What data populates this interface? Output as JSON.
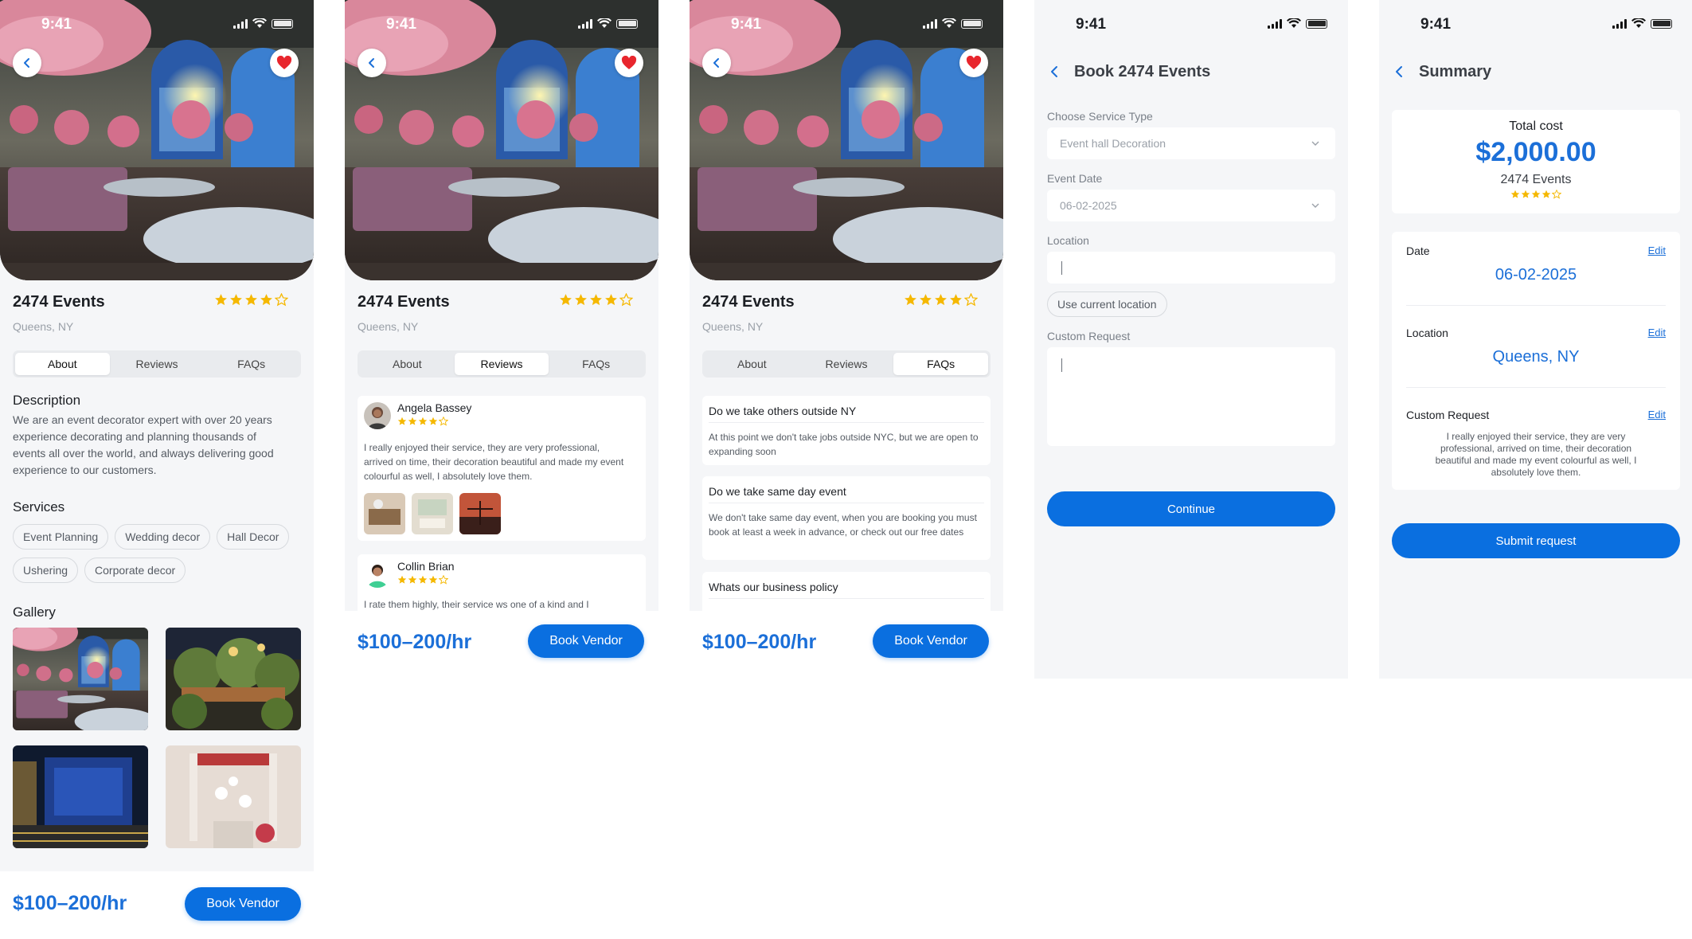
{
  "status": {
    "time": "9:41"
  },
  "vendor": {
    "name": "2474 Events",
    "location": "Queens, NY",
    "rating": 4,
    "rating_max": 5,
    "price": "$100–200/hr",
    "book_label": "Book Vendor"
  },
  "tabs": [
    "About",
    "Reviews",
    "FAQs"
  ],
  "about": {
    "description_title": "Description",
    "description": "We are an event decorator expert with over 20 years experience decorating and planning thousands of events all over the world, and always delivering good experience to our customers.",
    "services_title": "Services",
    "services": [
      "Event Planning",
      "Wedding decor",
      "Hall Decor",
      "Ushering",
      "Corporate decor"
    ],
    "gallery_title": "Gallery"
  },
  "reviews": [
    {
      "name": "Angela Bassey",
      "rating": 4,
      "text": "I really enjoyed their service, they are very professional, arrived on time, their decoration beautiful and made my event colourful as well, I absolutely love them."
    },
    {
      "name": "Collin Brian",
      "rating": 4,
      "text": "I rate them highly, their service ws one of a kind and I"
    }
  ],
  "faqs": [
    {
      "q": "Do we take others outside NY",
      "a": "At this point we don't take jobs outside NYC, but we are open to expanding soon"
    },
    {
      "q": "Do we take same day event",
      "a": "We don't take same day event, when you are booking you must book at least a week in advance, or check out our free dates"
    },
    {
      "q": "Whats our business policy",
      "a": ""
    }
  ],
  "booking": {
    "title": "Book 2474 Events",
    "service_label": "Choose Service Type",
    "service_value": "Event hall Decoration",
    "date_label": "Event Date",
    "date_value": "06-02-2025",
    "location_label": "Location",
    "location_chip": "Use current location",
    "request_label": "Custom Request",
    "continue_label": "Continue"
  },
  "summary": {
    "title": "Summary",
    "total_label": "Total cost",
    "total_value": "$2,000.00",
    "vendor_name": "2474 Events",
    "rating": 4,
    "date_label": "Date",
    "date_value": "06-02-2025",
    "location_label": "Location",
    "location_value": "Queens, NY",
    "request_label": "Custom Request",
    "request_value": "I really enjoyed their service, they are very professional, arrived on time, their decoration beautiful and made my event colourful as well, I absolutely love them.",
    "edit_label": "Edit",
    "submit_label": "Submit request"
  },
  "colors": {
    "accent": "#0a6fe0",
    "price": "#1b6fd8",
    "star": "#f5b800",
    "heart": "#e8262d",
    "background": "#f5f6f8"
  },
  "icons": [
    "back-arrow-icon",
    "heart-icon",
    "star-icon",
    "signal-icon",
    "wifi-icon",
    "battery-icon",
    "chevron-down-icon"
  ]
}
